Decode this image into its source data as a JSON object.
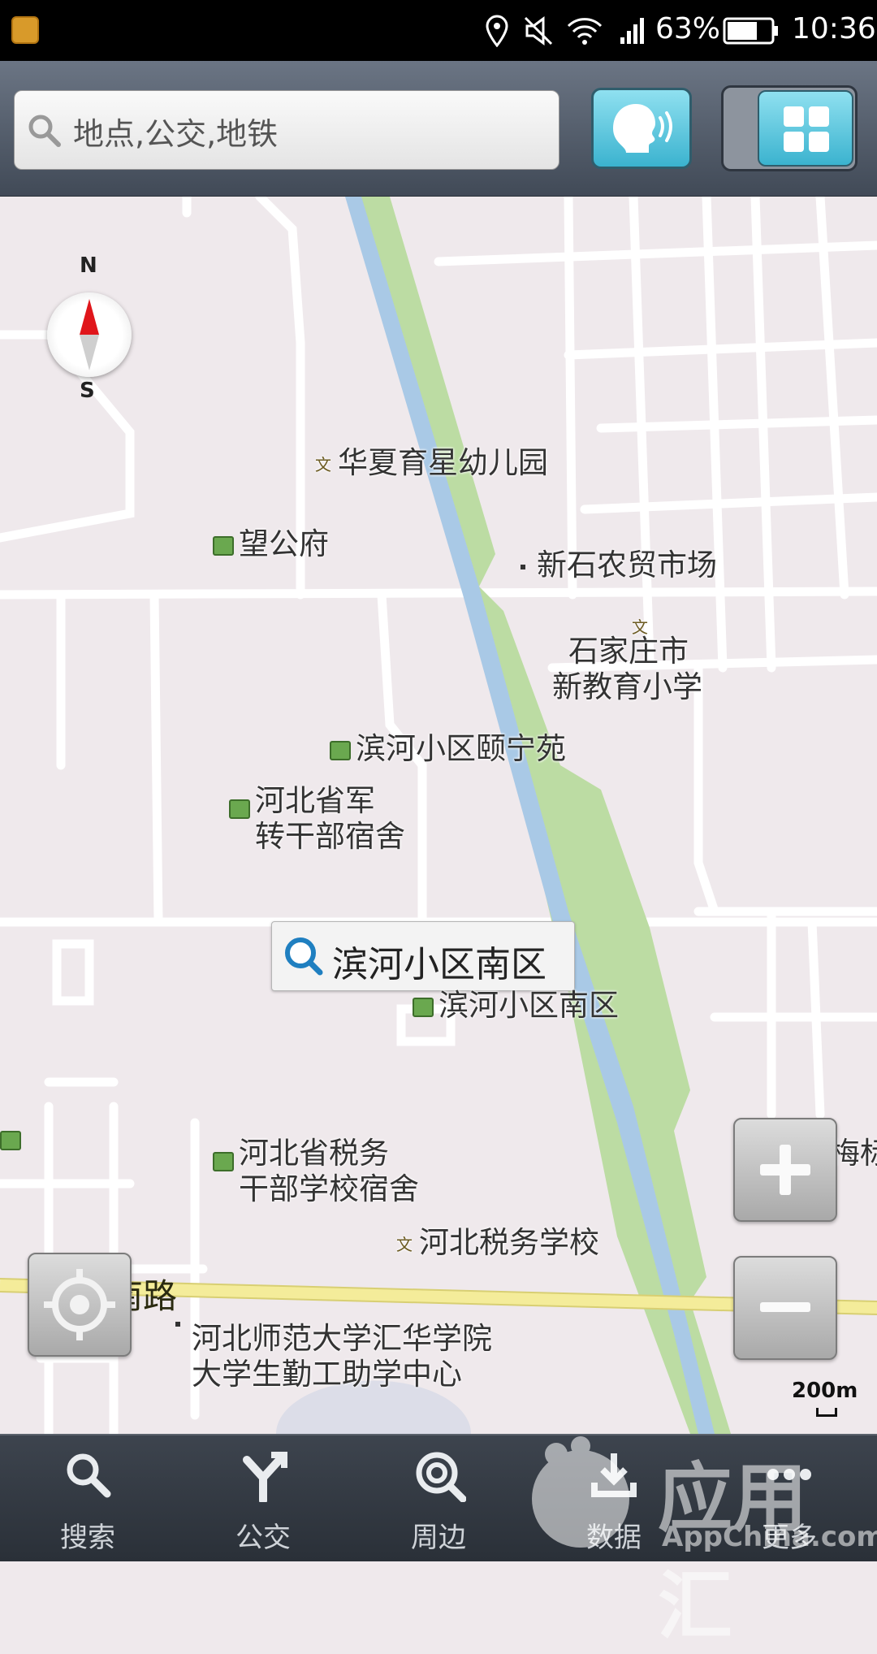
{
  "status_bar": {
    "battery": "63%",
    "time": "10:36"
  },
  "search": {
    "placeholder": "地点,公交,地铁"
  },
  "header": {
    "voice_icon": "voice-search-icon",
    "grid_icon": "grid-menu-icon"
  },
  "compass": {
    "north": "N",
    "south": "S"
  },
  "map": {
    "pois": {
      "kindergarten": "华夏育星幼儿园",
      "wanggongfu": "望公府",
      "market": "新石农贸市场",
      "school_line1": "石家庄市",
      "school_line2": "新教育小学",
      "ningyuan": "滨河小区颐宁苑",
      "military_line1": "河北省军",
      "military_line2": "转干部宿舍",
      "binhe_south": "滨河小区南区",
      "tax_dorm_line1": "河北省税务",
      "tax_dorm_line2": "干部学校宿舍",
      "tax_school": "河北税务学校",
      "huihua_line1": "河北师范大学汇华学院",
      "huihua_line2": "大学生勤工助学中心",
      "mei_partial": "梅标"
    },
    "road": "新石南路",
    "callout": "滨河小区南区",
    "scale": "200m"
  },
  "tabs": [
    {
      "label": "搜索",
      "icon": "search-icon"
    },
    {
      "label": "公交",
      "icon": "bus-route-icon"
    },
    {
      "label": "周边",
      "icon": "nearby-icon"
    },
    {
      "label": "数据",
      "icon": "download-icon"
    },
    {
      "label": "更多",
      "icon": "more-icon"
    }
  ],
  "watermark": {
    "brand": "应用汇",
    "site": "AppChina.com"
  },
  "colors": {
    "river": "#a9c9e6",
    "green_belt": "#bcdca3",
    "road_yellow": "#f4ec9a",
    "accent_blue": "#4fc2dd"
  }
}
